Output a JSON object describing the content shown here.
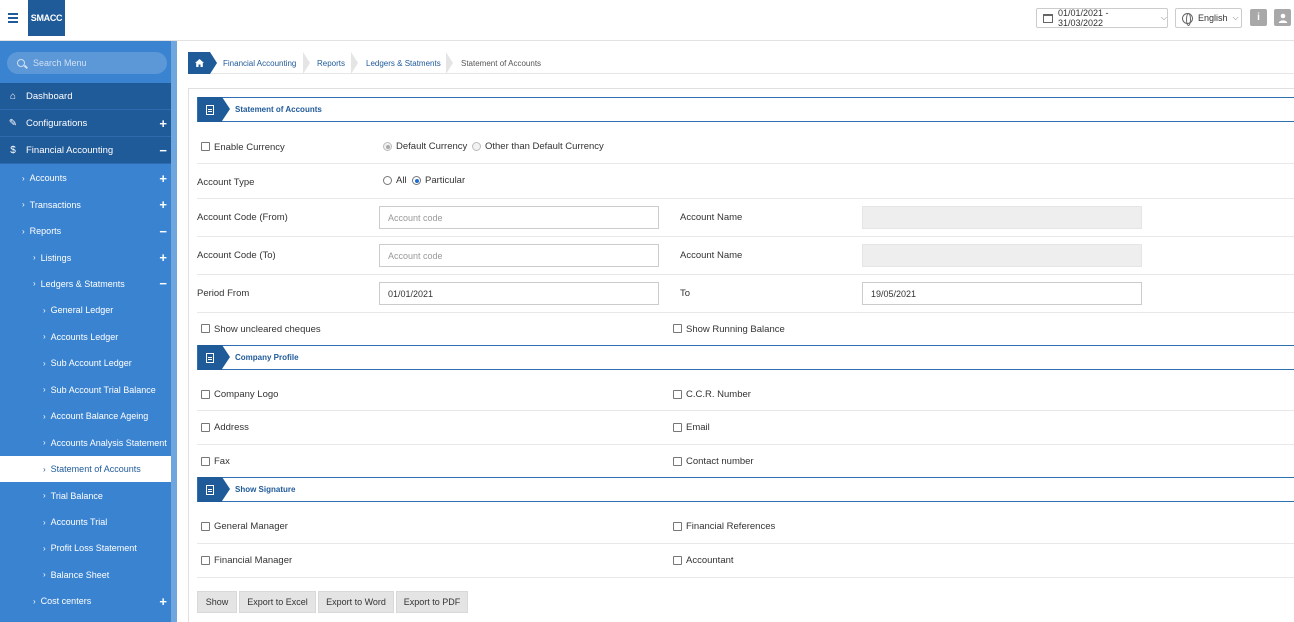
{
  "header": {
    "logo_text": "SMACC",
    "date_range": "01/01/2021 - 31/03/2022",
    "language": "English",
    "info_label": "i"
  },
  "sidebar": {
    "search_placeholder": "Search Menu",
    "top_items": [
      {
        "label": "Dashboard",
        "icon": "home-icon",
        "toggle": ""
      },
      {
        "label": "Configurations",
        "icon": "wrench-icon",
        "toggle": "+"
      },
      {
        "label": "Financial Accounting",
        "icon": "dollar-icon",
        "toggle": "−"
      }
    ],
    "sub_items": [
      {
        "label": "Accounts",
        "toggle": "+"
      },
      {
        "label": "Transactions",
        "toggle": "+"
      },
      {
        "label": "Reports",
        "toggle": "−"
      },
      {
        "label": "Listings",
        "toggle": "+"
      },
      {
        "label": "Ledgers & Statments",
        "toggle": "−"
      },
      {
        "label": "General Ledger",
        "toggle": ""
      },
      {
        "label": "Accounts Ledger",
        "toggle": ""
      },
      {
        "label": "Sub Account Ledger",
        "toggle": ""
      },
      {
        "label": "Sub Account Trial Balance",
        "toggle": ""
      },
      {
        "label": "Account Balance Ageing",
        "toggle": ""
      },
      {
        "label": "Accounts Analysis Statement",
        "toggle": ""
      },
      {
        "label": "Statement of Accounts",
        "toggle": ""
      },
      {
        "label": "Trial Balance",
        "toggle": ""
      },
      {
        "label": "Accounts Trial",
        "toggle": ""
      },
      {
        "label": "Profit Loss Statement",
        "toggle": ""
      },
      {
        "label": "Balance Sheet",
        "toggle": ""
      },
      {
        "label": "Cost centers",
        "toggle": "+"
      }
    ]
  },
  "breadcrumb": [
    "Financial Accounting",
    "Reports",
    "Ledgers & Statments",
    "Statement of Accounts"
  ],
  "sections": {
    "statement": "Statement of Accounts",
    "company": "Company Profile",
    "signature": "Show Signature"
  },
  "form": {
    "enable_currency": "Enable Currency",
    "default_currency": "Default Currency",
    "other_currency": "Other than Default Currency",
    "account_type": "Account Type",
    "type_all": "All",
    "type_particular": "Particular",
    "code_from": "Account Code (From)",
    "code_to": "Account Code (To)",
    "code_placeholder": "Account code",
    "account_name": "Account Name",
    "period_from": "Period From",
    "period_from_value": "01/01/2021",
    "to": "To",
    "period_to_value": "19/05/2021",
    "uncleared": "Show uncleared cheques",
    "running_balance": "Show Running Balance"
  },
  "company": {
    "logo": "Company Logo",
    "ccr": "C.C.R. Number",
    "address": "Address",
    "email": "Email",
    "fax": "Fax",
    "contact": "Contact number"
  },
  "signature": {
    "gm": "General Manager",
    "fin_ref": "Financial References",
    "fm": "Financial Manager",
    "accountant": "Accountant"
  },
  "buttons": {
    "show": "Show",
    "excel": "Export to Excel",
    "word": "Export to Word",
    "pdf": "Export to PDF"
  }
}
